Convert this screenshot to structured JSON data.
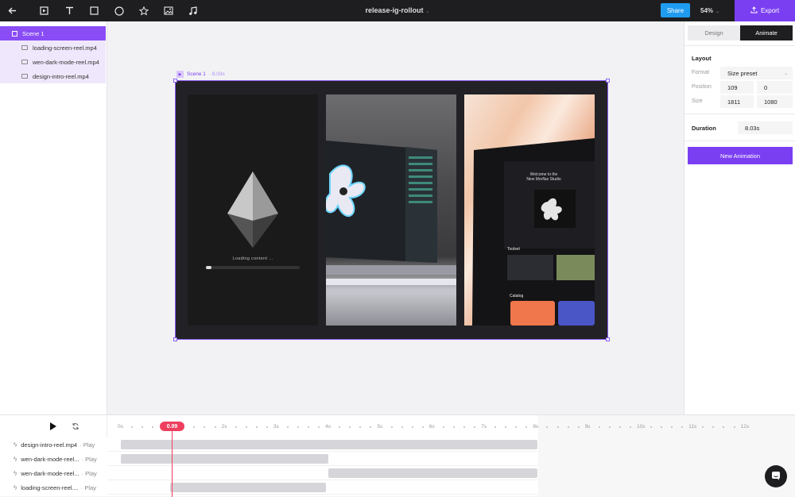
{
  "app": {
    "doc_title": "release-ig-rollout",
    "share_label": "Share",
    "zoom": "54%",
    "export_label": "Export",
    "accent": "#7b3ff2"
  },
  "toolbar": {
    "tools": [
      {
        "name": "back-arrow-icon"
      },
      {
        "name": "play-frame-icon"
      },
      {
        "name": "text-icon"
      },
      {
        "name": "rectangle-icon"
      },
      {
        "name": "circle-icon"
      },
      {
        "name": "star-icon"
      },
      {
        "name": "image-icon"
      },
      {
        "name": "music-note-icon"
      }
    ]
  },
  "layers": {
    "scene": "Scene 1",
    "children": [
      "loading-screen-reel.mp4",
      "wen-dark-mode-reel.mp4",
      "design-intro-reel.mp4"
    ]
  },
  "canvas": {
    "scene_label": "Scene 1",
    "scene_duration": "· 8.03s",
    "loading_text": "Loading content ...",
    "loading_progress": 0.06
  },
  "right_panel": {
    "tab_design": "Design",
    "tab_animate": "Animate",
    "layout_title": "Layout",
    "format_label": "Format",
    "format_value": "Size preset",
    "position_label": "Position",
    "position_x": "109",
    "position_y": "0",
    "size_label": "Size",
    "size_w": "1811",
    "size_h": "1080",
    "duration_label": "Duration",
    "duration_value": "8.03s",
    "new_animation": "New Animation"
  },
  "timeline": {
    "playhead": "0.99",
    "ticks": [
      "0s",
      "1s",
      "2s",
      "3s",
      "4s",
      "5s",
      "6s",
      "7s",
      "8s",
      "9s",
      "10s",
      "11s",
      "12s"
    ],
    "tracks": [
      {
        "name": "design-intro-reel.mp4",
        "action": "· Play",
        "start": 0.0,
        "end": 8.03
      },
      {
        "name": "wen-dark-mode-reel...",
        "action": "· Play",
        "start": 0.0,
        "end": 4.0
      },
      {
        "name": "wen-dark-mode-reel...",
        "action": "· Play",
        "start": 4.0,
        "end": 8.03
      },
      {
        "name": "loading-screen-reel....",
        "action": "· Play",
        "start": 0.95,
        "end": 3.95
      }
    ]
  }
}
